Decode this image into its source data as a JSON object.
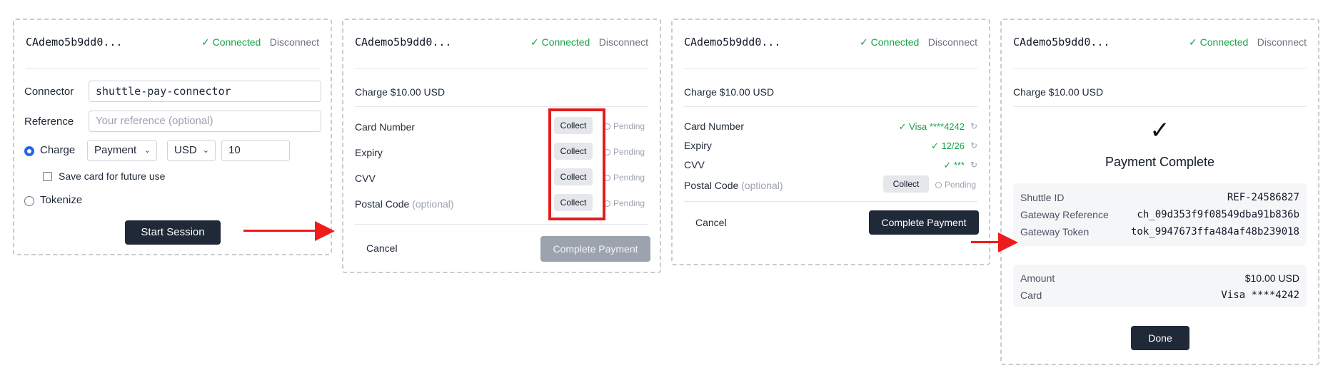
{
  "session_id": "CAdemo5b9dd0...",
  "status_connected": "✓ Connected",
  "disconnect_label": "Disconnect",
  "form": {
    "connector_label": "Connector",
    "connector_value": "shuttle-pay-connector",
    "reference_label": "Reference",
    "reference_placeholder": "Your reference (optional)",
    "charge_label": "Charge",
    "payment_type": "Payment",
    "currency": "USD",
    "amount": "10",
    "save_card_label": "Save card for future use",
    "tokenize_label": "Tokenize",
    "start_session_label": "Start Session"
  },
  "charge_title": "Charge $10.00 USD",
  "fields": {
    "card_number": "Card Number",
    "expiry": "Expiry",
    "cvv": "CVV",
    "postal_code": "Postal Code",
    "optional": "(optional)"
  },
  "collect_label": "Collect",
  "pending_label": "Pending",
  "collected": {
    "card_number": "✓ Visa ****4242",
    "expiry": "✓ 12/26",
    "cvv": "✓ ***"
  },
  "cancel_label": "Cancel",
  "complete_payment_label": "Complete Payment",
  "complete": {
    "checkmark": "✓",
    "title": "Payment Complete",
    "shuttle_id_label": "Shuttle ID",
    "shuttle_id_value": "REF-24586827",
    "gateway_ref_label": "Gateway Reference",
    "gateway_ref_value": "ch_09d353f9f08549dba91b836b",
    "gateway_token_label": "Gateway Token",
    "gateway_token_value": "tok_9947673ffa484af48b239018",
    "amount_label": "Amount",
    "amount_value": "$10.00 USD",
    "card_label": "Card",
    "card_value": "Visa ****4242",
    "done_label": "Done"
  },
  "colors": {
    "accent_dark": "#1f2937",
    "success": "#16a34a",
    "annotation_red": "#ee1c1c",
    "radio_blue": "#2563eb"
  },
  "icons": [
    "check-icon",
    "chevron-down-icon",
    "pending-circle-icon",
    "refresh-icon",
    "arrow-right-icon"
  ]
}
